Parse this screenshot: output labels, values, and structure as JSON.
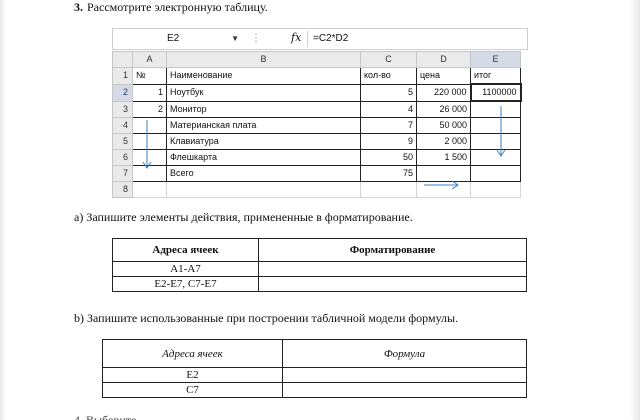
{
  "question": {
    "number": "3.",
    "text": "Рассмотрите электронную таблицу."
  },
  "spreadsheet": {
    "name_box": "E2",
    "fx_label": "fx",
    "formula": "=C2*D2",
    "columns": [
      "A",
      "B",
      "C",
      "D",
      "E"
    ],
    "rows": [
      {
        "n": "1",
        "a": "№",
        "b": "Наименование",
        "c": "кол-во",
        "d": "цена",
        "e": "итог"
      },
      {
        "n": "2",
        "a": "1",
        "b": "Ноутбук",
        "c": "5",
        "d": "220 000",
        "e": "1100000"
      },
      {
        "n": "3",
        "a": "2",
        "b": "Монитор",
        "c": "4",
        "d": "26 000",
        "e": ""
      },
      {
        "n": "4",
        "a": "",
        "b": "Материанская плата",
        "c": "7",
        "d": "50 000",
        "e": ""
      },
      {
        "n": "5",
        "a": "",
        "b": "Клавиатура",
        "c": "9",
        "d": "2 000",
        "e": ""
      },
      {
        "n": "6",
        "a": "",
        "b": "Флешкарта",
        "c": "50",
        "d": "1 500",
        "e": ""
      },
      {
        "n": "7",
        "a": "",
        "b": "Всего",
        "c": "75",
        "d": "",
        "e": ""
      },
      {
        "n": "8",
        "a": "",
        "b": "",
        "c": "",
        "d": "",
        "e": ""
      }
    ],
    "annotation_color": "#3b7fc4",
    "selection_header_color": "#d5dbe6"
  },
  "task_a": {
    "text": "а) Запишите элементы действия, примененные в форматирование.",
    "headers": [
      "Адреса ячеек",
      "Форматирование"
    ],
    "rows": [
      [
        "A1-A7",
        ""
      ],
      [
        "E2-E7, C7-E7",
        ""
      ]
    ]
  },
  "task_b": {
    "text": "b) Запишите использованные при построении табличной модели формулы.",
    "headers": [
      "Адреса ячеек",
      "Формула"
    ],
    "rows": [
      [
        "E2",
        ""
      ],
      [
        "C7",
        ""
      ]
    ]
  },
  "next_question_fragment": "4. Выберите ..."
}
